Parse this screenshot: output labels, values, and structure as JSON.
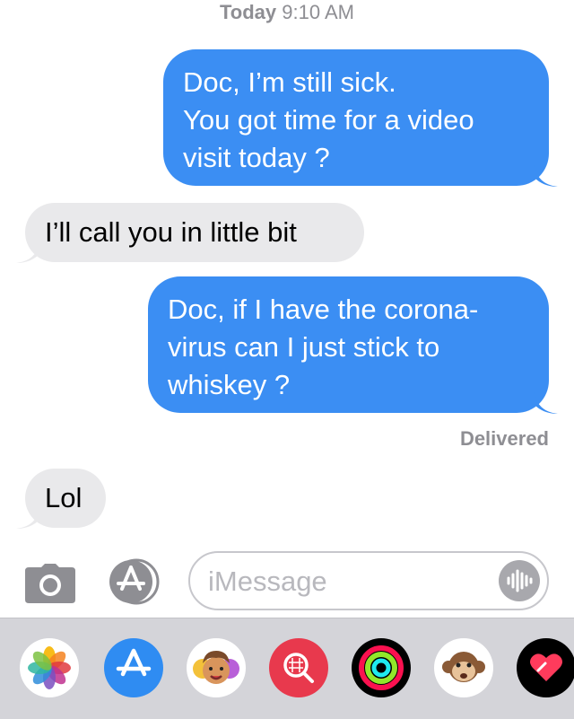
{
  "header": {
    "day": "Today",
    "time": "9:10 AM"
  },
  "messages": [
    {
      "direction": "outgoing",
      "text": "Doc, I’m still sick.\nYou got time for a video\nvisit today ?"
    },
    {
      "direction": "incoming",
      "text": "I’ll call you in little bit"
    },
    {
      "direction": "outgoing",
      "text": "Doc, if I have the corona-\nvirus can I just stick to\nwhiskey ?"
    },
    {
      "direction": "incoming",
      "text": "Lol"
    }
  ],
  "status": {
    "delivered": "Delivered"
  },
  "composer": {
    "placeholder": "iMessage",
    "value": "",
    "camera_icon": "camera-icon",
    "apps_icon": "app-store-icon",
    "audio_icon": "audio-waveform-icon"
  },
  "drawer": {
    "apps": [
      {
        "name": "photos-app-icon"
      },
      {
        "name": "app-store-app-icon"
      },
      {
        "name": "memoji-app-icon"
      },
      {
        "name": "images-search-app-icon"
      },
      {
        "name": "activity-app-icon"
      },
      {
        "name": "animoji-app-icon"
      },
      {
        "name": "digital-touch-app-icon"
      }
    ]
  },
  "colors": {
    "outgoing_bubble": "#3b8ef3",
    "incoming_bubble": "#e9e9eb",
    "secondary_text": "#8e8e93",
    "drawer_background": "#d4d4d9"
  }
}
